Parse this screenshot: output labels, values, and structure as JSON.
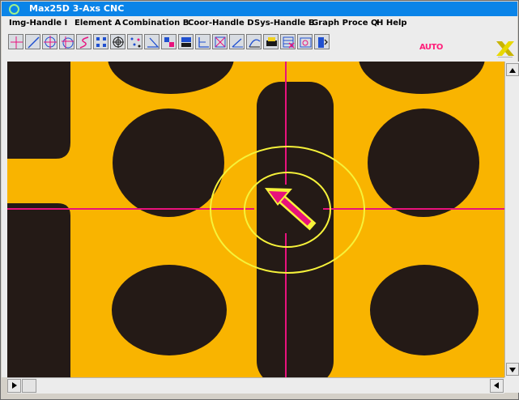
{
  "window": {
    "title": "Max25D 3-Axs CNC",
    "colors": {
      "titlebar": "#0a84e8",
      "pad": "#f9b400",
      "substrate": "#241a16",
      "crosshair": "#e8127c",
      "circle": "#f6f23a",
      "auto": "#ff1f7a"
    }
  },
  "menu": [
    {
      "label": "Img-Handle I"
    },
    {
      "label": "Element A"
    },
    {
      "label": "Combination B"
    },
    {
      "label": "Coor-Handle D"
    },
    {
      "label": "Sys-Handle E"
    },
    {
      "label": "Graph Proce Q"
    },
    {
      "label": "H Help"
    }
  ],
  "toolbar": {
    "tools": [
      {
        "icon": "cross-icon"
      },
      {
        "icon": "line-icon"
      },
      {
        "icon": "circle-center-icon"
      },
      {
        "icon": "circle-offset-icon"
      },
      {
        "icon": "curve-icon"
      },
      {
        "icon": "grid-points-icon"
      },
      {
        "icon": "target-icon"
      },
      {
        "icon": "scatter-icon"
      },
      {
        "icon": "angle-icon"
      },
      {
        "icon": "color-block-icon"
      },
      {
        "icon": "pattern-icon"
      },
      {
        "icon": "axis-icon"
      },
      {
        "icon": "diagonal-box-icon"
      },
      {
        "icon": "slope-icon"
      },
      {
        "icon": "auto-curve-icon"
      },
      {
        "icon": "print-icon"
      },
      {
        "icon": "close-grid-icon"
      },
      {
        "icon": "camera-icon"
      },
      {
        "icon": "exit-icon"
      }
    ],
    "mode_label": "AUTO",
    "logo_icon": "x-logo-icon"
  },
  "scrollbars": {
    "vertical": {
      "up_icon": "arrow-up-icon",
      "down_icon": "arrow-down-icon"
    },
    "horizontal": {
      "left_icon": "arrow-left-icon",
      "right_icon": "arrow-right-icon"
    }
  }
}
